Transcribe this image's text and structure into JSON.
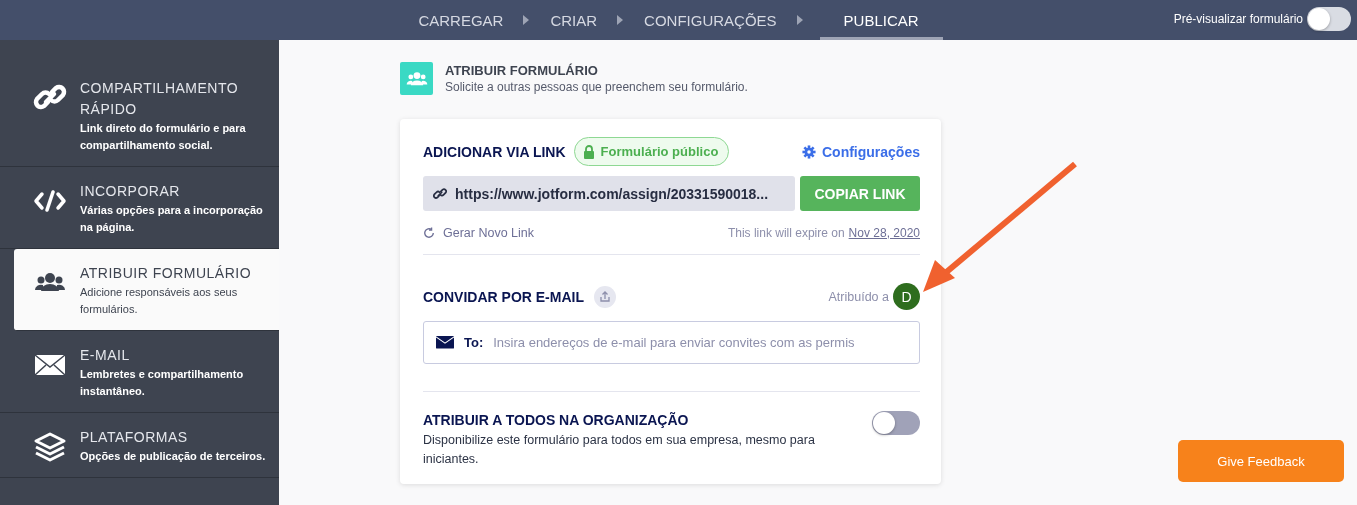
{
  "topbar": {
    "steps": [
      {
        "label": "CARREGAR",
        "selected": false
      },
      {
        "label": "CRIAR",
        "selected": false
      },
      {
        "label": "CONFIGURAÇÕES",
        "selected": false
      },
      {
        "label": "PUBLICAR",
        "selected": true
      }
    ],
    "preview": {
      "label": "Pré-visualizar formulário",
      "on": false
    }
  },
  "sidebar": {
    "items": [
      {
        "title": "COMPARTILHAMENTO RÁPIDO",
        "description": "Link direto do formulário e para compartilhamento social.",
        "selected": false
      },
      {
        "title": "INCORPORAR",
        "description": "Várias opções para a incorporação na página.",
        "selected": false
      },
      {
        "title": "ATRIBUIR FORMULÁRIO",
        "description": "Adicione responsáveis aos seus formulários.",
        "selected": true
      },
      {
        "title": "E-MAIL",
        "description": "Lembretes e compartilhamento instantâneo.",
        "selected": false
      },
      {
        "title": "PLATAFORMAS",
        "description": "Opções de publicação de terceiros.",
        "selected": false
      }
    ]
  },
  "header": {
    "title": "ATRIBUIR FORMULÁRIO",
    "subtitle": "Solicite a outras pessoas que preenchem seu formulário."
  },
  "link_section": {
    "title": "ADICIONAR VIA LINK",
    "badge": "Formulário público",
    "settings": "Configurações",
    "url": "https://www.jotform.com/assign/20331590018...",
    "copy_button": "COPIAR LINK",
    "regenerate": "Gerar Novo Link",
    "expiry_text": "This link will expire on",
    "expiry_date": "Nov 28, 2020"
  },
  "email_section": {
    "title": "CONVIDAR POR E-MAIL",
    "assigned_label": "Atribuído a",
    "assignee_initial": "D",
    "to_label": "To:",
    "placeholder": "Insira endereços de e-mail para enviar convites com as permis"
  },
  "organization_section": {
    "title": "ATRIBUIR A TODOS NA ORGANIZAÇÃO",
    "description": "Disponibilize este formulário para todos em sua empresa, mesmo para iniciantes.",
    "on": false
  },
  "feedback_button": "Give Feedback"
}
